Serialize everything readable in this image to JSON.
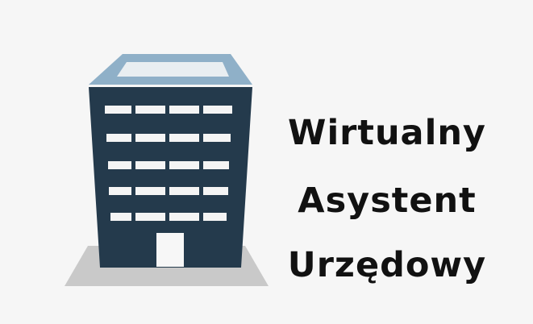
{
  "title": {
    "line1": "Wirtualny",
    "line2": "Asystent",
    "line3": "Urzędowy"
  },
  "colors": {
    "background": "#f6f6f6",
    "building_facade": "#243a4c",
    "roof_frame": "#8fb0c8",
    "roof_glass": "#e9eef1",
    "windows": "#f4f4f4",
    "shadow": "#c9c9c9",
    "text": "#111111"
  },
  "icons": {
    "building": "office-building-icon"
  }
}
